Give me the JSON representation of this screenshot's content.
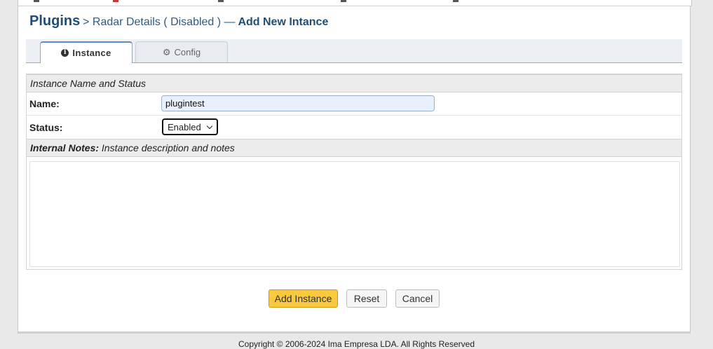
{
  "header": {
    "title": "Plugins",
    "crumb": "> Radar Details ( Disabled ) —",
    "action": "Add New Intance"
  },
  "tabs": [
    {
      "label": "Instance",
      "icon": "info-icon",
      "active": true
    },
    {
      "label": "Config",
      "icon": "gear-icon",
      "active": false
    }
  ],
  "form": {
    "section_title": "Instance Name and Status",
    "name_label": "Name:",
    "name_value": "plugintest",
    "status_label": "Status:",
    "status_value": "Enabled",
    "notes_label": "Internal Notes:",
    "notes_desc": "Instance description and notes",
    "notes_value": ""
  },
  "buttons": {
    "add": "Add Instance",
    "reset": "Reset",
    "cancel": "Cancel"
  },
  "footer": {
    "text": "Copyright © 2006-2024 Ima Empresa LDA. All Rights Reserved"
  },
  "colors": {
    "accent": "#1f4e79",
    "primary_button": "#f8c93e"
  }
}
